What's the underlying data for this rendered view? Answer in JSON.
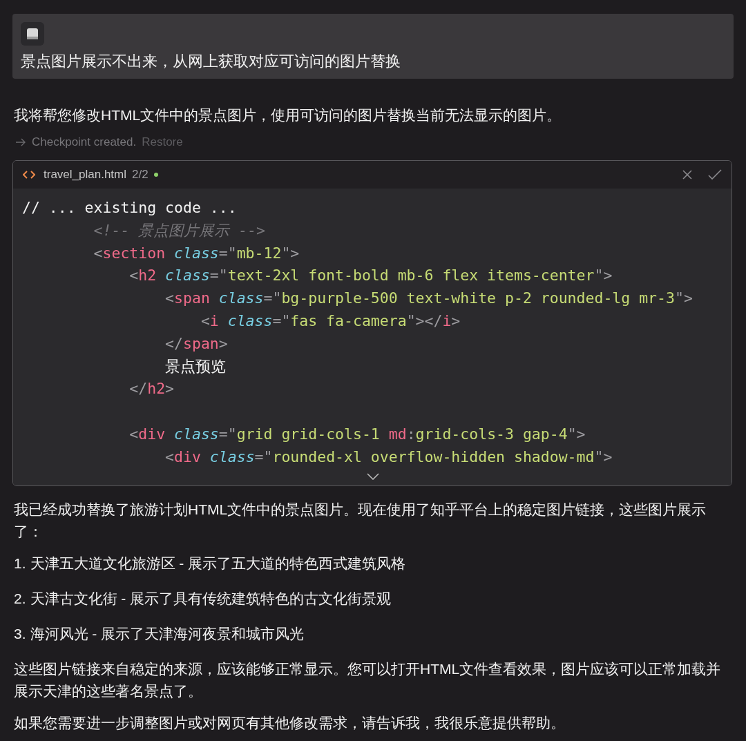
{
  "user_message": {
    "text": "景点图片展示不出来，从网上获取对应可访问的图片替换"
  },
  "intro": "我将帮您修改HTML文件中的景点图片，使用可访问的图片替换当前无法显示的图片。",
  "checkpoint": {
    "label": "Checkpoint created.",
    "action": "Restore"
  },
  "code_block": {
    "filename": "travel_plan.html",
    "counter": "2/2",
    "modified": true,
    "lines": [
      {
        "kind": "code",
        "tokens": [
          {
            "kind": "text",
            "text": "// ... existing code ..."
          }
        ]
      },
      {
        "kind": "code",
        "tokens": [
          {
            "kind": "comment",
            "text": "        <!-- 景点图片展示 -->"
          }
        ]
      },
      {
        "kind": "code",
        "tokens": [
          {
            "kind": "punct",
            "text": "        <"
          },
          {
            "kind": "tag",
            "text": "section"
          },
          {
            "kind": "attr",
            "text": " class"
          },
          {
            "kind": "punct",
            "text": "=\""
          },
          {
            "kind": "string",
            "text": "mb-12"
          },
          {
            "kind": "punct",
            "text": "\">"
          }
        ]
      },
      {
        "kind": "code",
        "tokens": [
          {
            "kind": "punct",
            "text": "            <"
          },
          {
            "kind": "tag",
            "text": "h2"
          },
          {
            "kind": "attr",
            "text": " class"
          },
          {
            "kind": "punct",
            "text": "=\""
          },
          {
            "kind": "string",
            "text": "text-2xl font-bold mb-6 flex items-center"
          },
          {
            "kind": "punct",
            "text": "\">"
          }
        ]
      },
      {
        "kind": "code",
        "tokens": [
          {
            "kind": "punct",
            "text": "                <"
          },
          {
            "kind": "tag",
            "text": "span"
          },
          {
            "kind": "attr",
            "text": " class"
          },
          {
            "kind": "punct",
            "text": "=\""
          },
          {
            "kind": "string",
            "text": "bg-purple-500 text-white p-2 rounded-lg mr-3"
          },
          {
            "kind": "punct",
            "text": "\">"
          }
        ]
      },
      {
        "kind": "code",
        "tokens": [
          {
            "kind": "punct",
            "text": "                    <"
          },
          {
            "kind": "tag",
            "text": "i"
          },
          {
            "kind": "attr",
            "text": " class"
          },
          {
            "kind": "punct",
            "text": "=\""
          },
          {
            "kind": "string",
            "text": "fas fa-camera"
          },
          {
            "kind": "punct",
            "text": "\"></"
          },
          {
            "kind": "tag",
            "text": "i"
          },
          {
            "kind": "punct",
            "text": ">"
          }
        ]
      },
      {
        "kind": "code",
        "tokens": [
          {
            "kind": "punct",
            "text": "                </"
          },
          {
            "kind": "tag",
            "text": "span"
          },
          {
            "kind": "punct",
            "text": ">"
          }
        ]
      },
      {
        "kind": "code",
        "tokens": [
          {
            "kind": "text",
            "text": "                景点预览"
          }
        ]
      },
      {
        "kind": "code",
        "tokens": [
          {
            "kind": "punct",
            "text": "            </"
          },
          {
            "kind": "tag",
            "text": "h2"
          },
          {
            "kind": "punct",
            "text": ">"
          }
        ]
      },
      {
        "kind": "blank"
      },
      {
        "kind": "code",
        "tokens": [
          {
            "kind": "punct",
            "text": "            <"
          },
          {
            "kind": "tag",
            "text": "div"
          },
          {
            "kind": "attr",
            "text": " class"
          },
          {
            "kind": "punct",
            "text": "=\""
          },
          {
            "kind": "string",
            "text": "grid grid-cols-1 "
          },
          {
            "kind": "tag",
            "text": "md"
          },
          {
            "kind": "punct",
            "text": ":"
          },
          {
            "kind": "string",
            "text": "grid-cols-3 gap-4"
          },
          {
            "kind": "punct",
            "text": "\">"
          }
        ]
      },
      {
        "kind": "code",
        "tokens": [
          {
            "kind": "punct",
            "text": "                <"
          },
          {
            "kind": "tag",
            "text": "div"
          },
          {
            "kind": "attr",
            "text": " class"
          },
          {
            "kind": "punct",
            "text": "=\""
          },
          {
            "kind": "string",
            "text": "rounded-xl overflow-hidden shadow-md"
          },
          {
            "kind": "punct",
            "text": "\">"
          }
        ]
      }
    ]
  },
  "response": [
    {
      "kind": "paragraph",
      "text": "我已经成功替换了旅游计划HTML文件中的景点图片。现在使用了知乎平台上的稳定图片链接，这些图片展示了："
    },
    {
      "kind": "list_item",
      "number": "1.",
      "text": "天津五大道文化旅游区 - 展示了五大道的特色西式建筑风格"
    },
    {
      "kind": "list_item",
      "number": "2.",
      "text": "天津古文化街 - 展示了具有传统建筑特色的古文化街景观"
    },
    {
      "kind": "list_item",
      "number": "3.",
      "text": "海河风光 - 展示了天津海河夜景和城市风光"
    },
    {
      "kind": "paragraph",
      "text": "这些图片链接来自稳定的来源，应该能够正常显示。您可以打开HTML文件查看效果，图片应该可以正常加载并展示天津的这些著名景点了。"
    },
    {
      "kind": "paragraph",
      "text": "如果您需要进一步调整图片或对网页有其他修改需求，请告诉我，我很乐意提供帮助。"
    }
  ]
}
